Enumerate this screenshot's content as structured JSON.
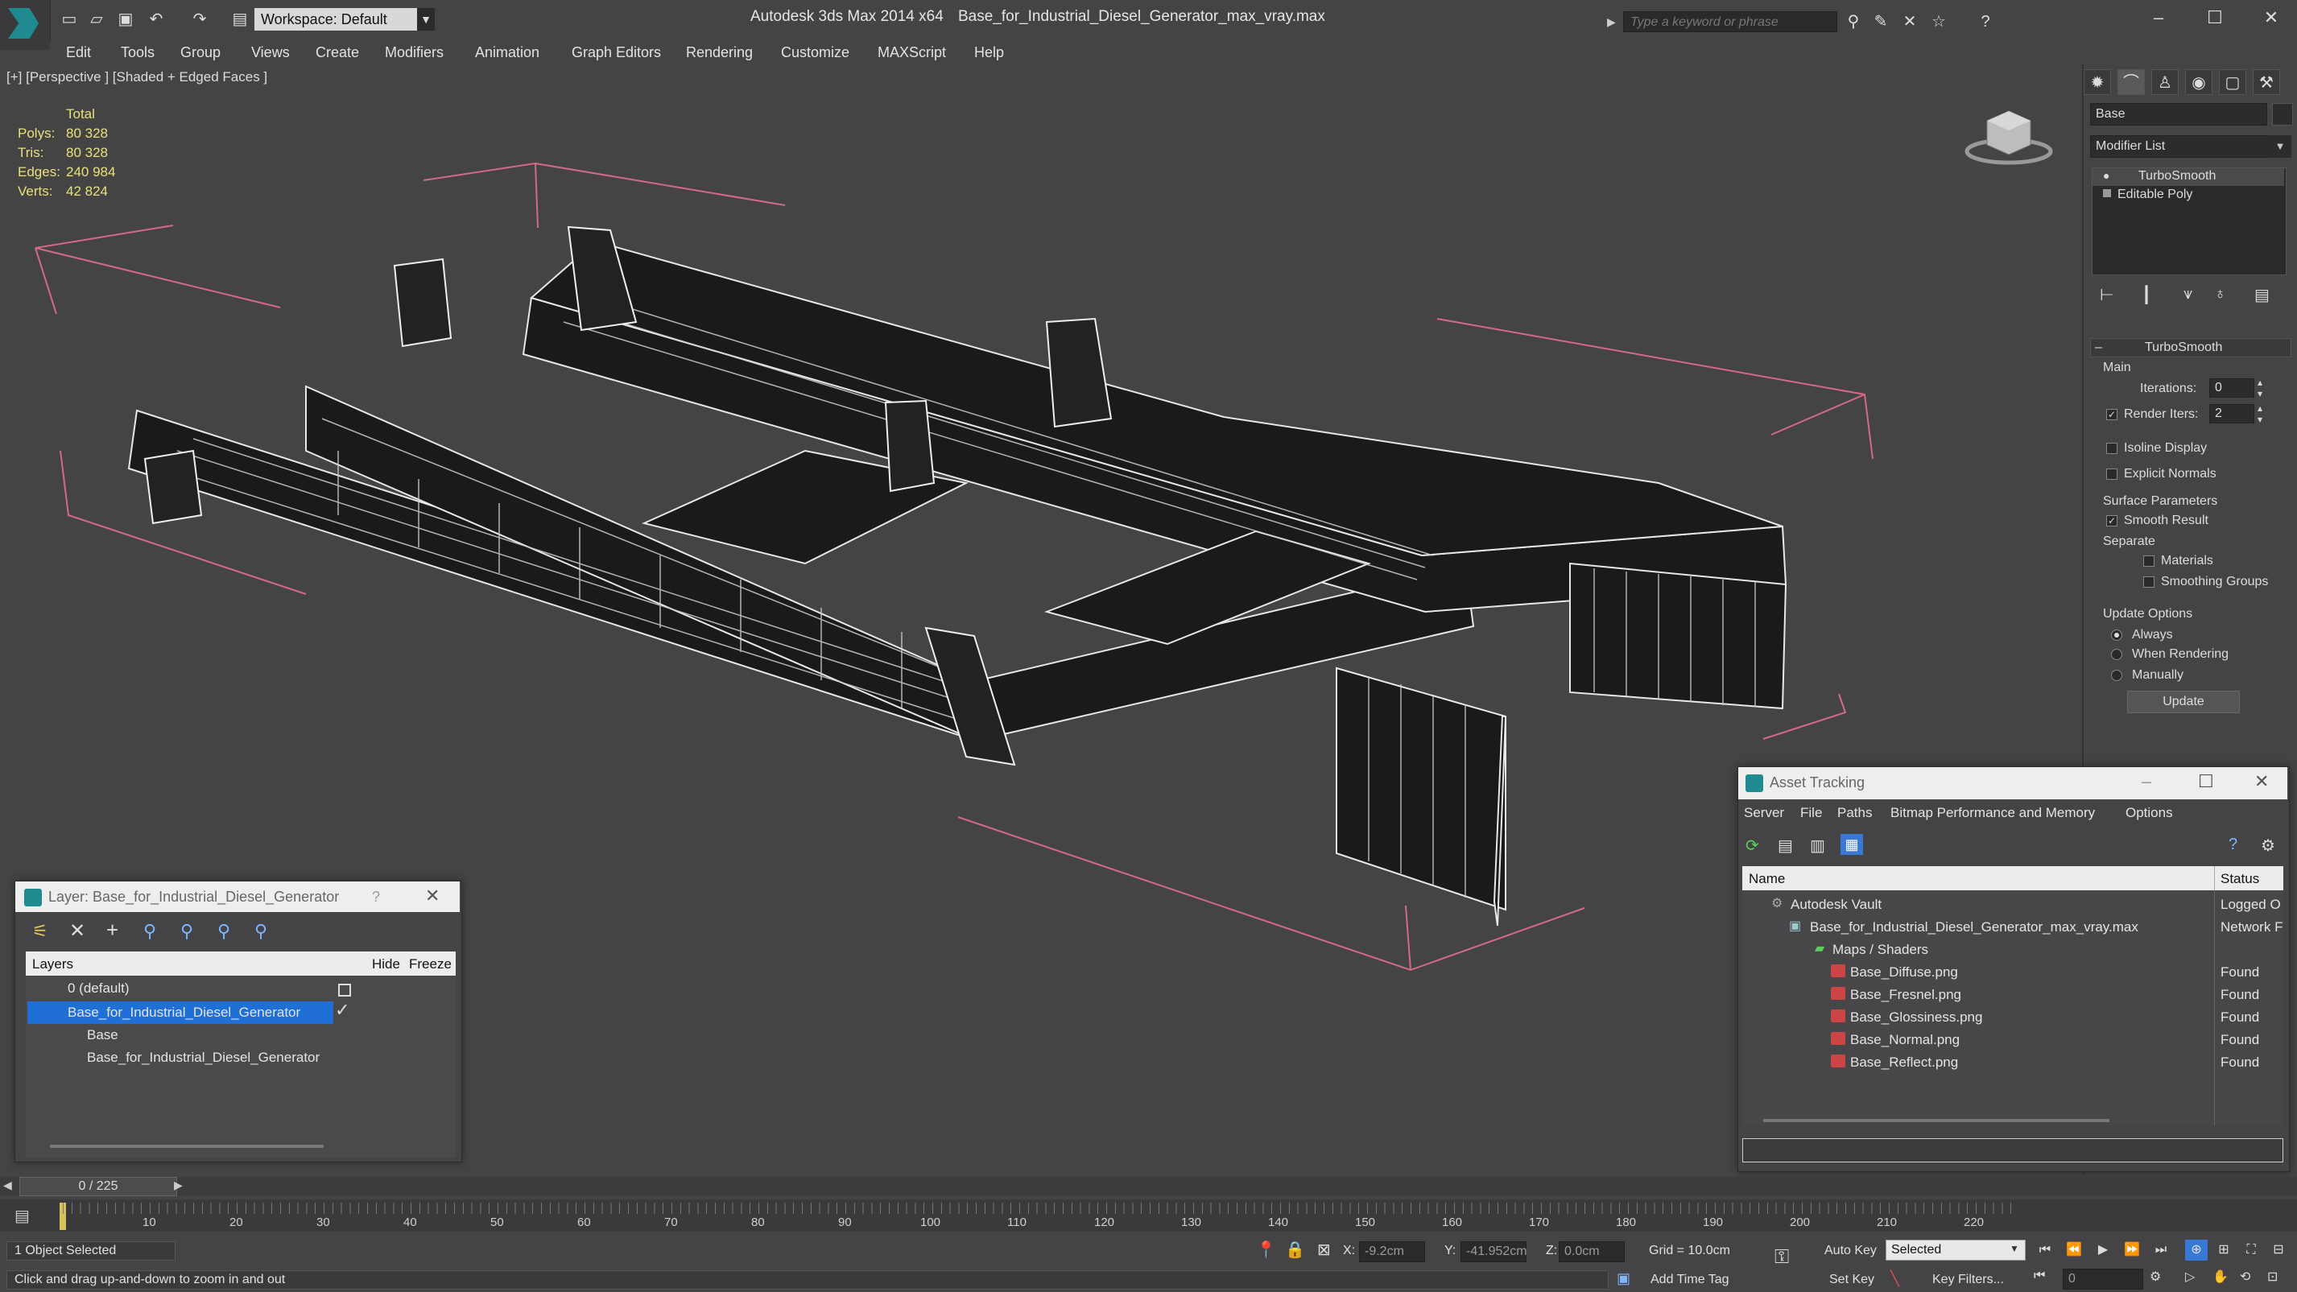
{
  "titlebar": {
    "workspace": "Workspace: Default",
    "app_name": "Autodesk 3ds Max  2014 x64",
    "file_name": "Base_for_Industrial_Diesel_Generator_max_vray.max",
    "search_placeholder": "Type a keyword or phrase"
  },
  "menu": [
    "Edit",
    "Tools",
    "Group",
    "Views",
    "Create",
    "Modifiers",
    "Animation",
    "Graph Editors",
    "Rendering",
    "Customize",
    "MAXScript",
    "Help"
  ],
  "viewport": {
    "label": "[+] [Perspective ] [Shaded + Edged Faces ]",
    "stats_header": "Total",
    "stats": [
      {
        "label": "Polys:",
        "value": "80 328"
      },
      {
        "label": "Tris:",
        "value": "80 328"
      },
      {
        "label": "Edges:",
        "value": "240 984"
      },
      {
        "label": "Verts:",
        "value": "42 824"
      }
    ]
  },
  "command_panel": {
    "object_name": "Base",
    "modifier_list": "Modifier List",
    "stack": [
      "TurboSmooth",
      "Editable Poly"
    ],
    "rollout_title": "TurboSmooth",
    "main_label": "Main",
    "iterations_label": "Iterations:",
    "iterations_value": "0",
    "render_iters_label": "Render Iters:",
    "render_iters_value": "2",
    "isoline": "Isoline Display",
    "explicit_normals": "Explicit Normals",
    "surface_params": "Surface Parameters",
    "smooth_result": "Smooth Result",
    "separate": "Separate",
    "materials": "Materials",
    "smoothing_groups": "Smoothing Groups",
    "update_options": "Update Options",
    "always": "Always",
    "when_rendering": "When Rendering",
    "manually": "Manually",
    "update_button": "Update"
  },
  "layer_window": {
    "title": "Layer: Base_for_Industrial_Diesel_Generator",
    "help": "?",
    "col_layers": "Layers",
    "col_hide": "Hide",
    "col_freeze": "Freeze",
    "rows": [
      {
        "name": "0 (default)"
      },
      {
        "name": "Base_for_Industrial_Diesel_Generator"
      },
      {
        "name": "Base"
      },
      {
        "name": "Base_for_Industrial_Diesel_Generator"
      }
    ]
  },
  "asset_window": {
    "title": "Asset Tracking",
    "menu": [
      "Server",
      "File",
      "Paths",
      "Bitmap Performance and Memory",
      "Options"
    ],
    "col_name": "Name",
    "col_status": "Status",
    "rows": [
      {
        "name": "Autodesk Vault",
        "status": "Logged O"
      },
      {
        "name": "Base_for_Industrial_Diesel_Generator_max_vray.max",
        "status": "Network F"
      },
      {
        "name": "Maps / Shaders",
        "status": ""
      },
      {
        "name": "Base_Diffuse.png",
        "status": "Found"
      },
      {
        "name": "Base_Fresnel.png",
        "status": "Found"
      },
      {
        "name": "Base_Glossiness.png",
        "status": "Found"
      },
      {
        "name": "Base_Normal.png",
        "status": "Found"
      },
      {
        "name": "Base_Reflect.png",
        "status": "Found"
      }
    ]
  },
  "timeline": {
    "frame": "0 / 225",
    "ticks": [
      "10",
      "20",
      "30",
      "40",
      "50",
      "60",
      "70",
      "80",
      "90",
      "100",
      "110",
      "120",
      "130",
      "140",
      "150",
      "160",
      "170",
      "180",
      "190",
      "200",
      "210",
      "220"
    ]
  },
  "statusbar": {
    "selection": "1 Object Selected",
    "prompt": "Click and drag up-and-down to zoom in and out",
    "x_label": "X:",
    "x_value": "-9.2cm",
    "y_label": "Y:",
    "y_value": "-41.952cm",
    "z_label": "Z:",
    "z_value": "0.0cm",
    "grid": "Grid = 10.0cm",
    "auto_key": "Auto Key",
    "selected": "Selected",
    "set_key": "Set Key",
    "key_filters": "Key Filters...",
    "add_time_tag": "Add Time Tag",
    "frame_value": "0"
  },
  "colors": {
    "selection_blue": "#1f6fd6",
    "stat_yellow": "#e8e07a",
    "bbox_pink": "#d46a86"
  }
}
